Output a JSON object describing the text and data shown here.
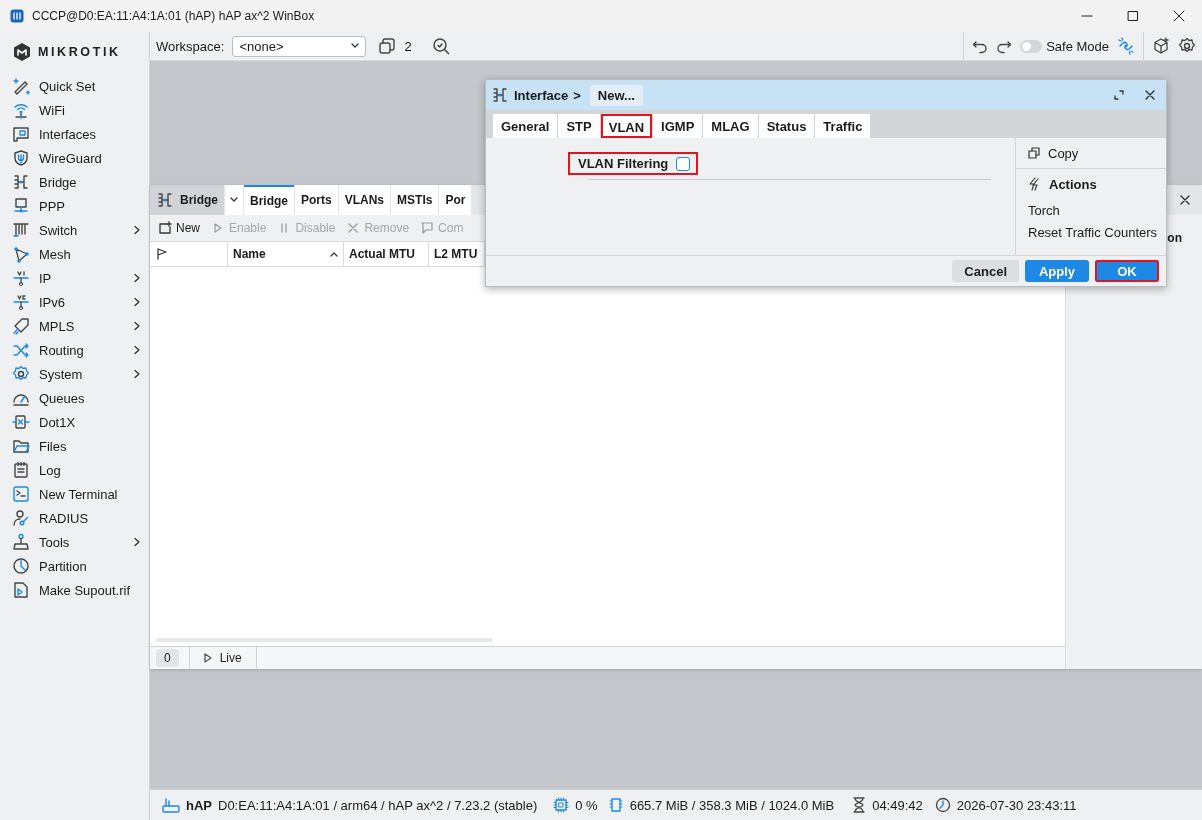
{
  "window": {
    "title": "CCCP@D0:EA:11:A4:1A:01 (hAP) hAP ax^2 WinBox"
  },
  "logo": {
    "text": "MIKROTIK"
  },
  "sidebar": {
    "items": [
      {
        "label": "Quick Set",
        "submenu": false
      },
      {
        "label": "WiFi",
        "submenu": false
      },
      {
        "label": "Interfaces",
        "submenu": false
      },
      {
        "label": "WireGuard",
        "submenu": false
      },
      {
        "label": "Bridge",
        "submenu": false
      },
      {
        "label": "PPP",
        "submenu": false
      },
      {
        "label": "Switch",
        "submenu": true
      },
      {
        "label": "Mesh",
        "submenu": false
      },
      {
        "label": "IP",
        "submenu": true
      },
      {
        "label": "IPv6",
        "submenu": true
      },
      {
        "label": "MPLS",
        "submenu": true
      },
      {
        "label": "Routing",
        "submenu": true
      },
      {
        "label": "System",
        "submenu": true
      },
      {
        "label": "Queues",
        "submenu": false
      },
      {
        "label": "Dot1X",
        "submenu": false
      },
      {
        "label": "Files",
        "submenu": false
      },
      {
        "label": "Log",
        "submenu": false
      },
      {
        "label": "New Terminal",
        "submenu": false
      },
      {
        "label": "RADIUS",
        "submenu": false
      },
      {
        "label": "Tools",
        "submenu": true
      },
      {
        "label": "Partition",
        "submenu": false
      },
      {
        "label": "Make Supout.rif",
        "submenu": false
      }
    ]
  },
  "toolbar": {
    "workspace_label": "Workspace:",
    "workspace_value": "<none>",
    "window_count": "2",
    "safe_mode": {
      "label": "Safe Mode",
      "on": false
    }
  },
  "bridge_window": {
    "title": "Bridge",
    "tabs": [
      {
        "label": "Bridge",
        "selected": true
      },
      {
        "label": "Ports",
        "selected": false
      },
      {
        "label": "VLANs",
        "selected": false
      },
      {
        "label": "MSTIs",
        "selected": false
      },
      {
        "label": "Por",
        "selected": false
      }
    ],
    "actions": [
      {
        "label": "New",
        "disabled": false
      },
      {
        "label": "Enable",
        "disabled": true
      },
      {
        "label": "Disable",
        "disabled": true
      },
      {
        "label": "Remove",
        "disabled": true
      },
      {
        "label": "Com",
        "disabled": true
      }
    ],
    "columns": [
      {
        "label": "Name",
        "sorted": true
      },
      {
        "label": "Actual MTU",
        "sorted": false
      },
      {
        "label": "L2 MTU",
        "sorted": false
      }
    ],
    "side_panel_text": "on",
    "item_count": "0",
    "live_label": "Live"
  },
  "dialog": {
    "breadcrumb": "Interface",
    "separator": ">",
    "title": "New...",
    "tabs": [
      {
        "label": "General",
        "selected": false,
        "highlighted": false
      },
      {
        "label": "STP",
        "selected": false,
        "highlighted": false
      },
      {
        "label": "VLAN",
        "selected": true,
        "highlighted": true
      },
      {
        "label": "IGMP",
        "selected": false,
        "highlighted": false
      },
      {
        "label": "MLAG",
        "selected": false,
        "highlighted": false
      },
      {
        "label": "Status",
        "selected": false,
        "highlighted": false
      },
      {
        "label": "Traffic",
        "selected": false,
        "highlighted": false
      }
    ],
    "fields": [
      {
        "label": "VLAN Filtering",
        "kind": "checkbox",
        "checked": false,
        "highlighted": true
      }
    ],
    "side_items": [
      {
        "label": "Copy",
        "kind": "command"
      },
      {
        "label": "Actions",
        "kind": "heading"
      },
      {
        "label": "Torch",
        "kind": "command"
      },
      {
        "label": "Reset Traffic Counters",
        "kind": "command"
      }
    ],
    "buttons": [
      {
        "label": "Cancel",
        "kind": "secondary",
        "highlighted": false
      },
      {
        "label": "Apply",
        "kind": "primary",
        "highlighted": false
      },
      {
        "label": "OK",
        "kind": "primary",
        "highlighted": true
      }
    ]
  },
  "status_bar": {
    "device": "hAP",
    "info": "D0:EA:11:A4:1A:01 / arm64 / hAP ax^2 / 7.23.2 (stable)",
    "cpu": "0 %",
    "memory": "665.7 MiB / 358.3 MiB / 1024.0 MiB",
    "uptime": "04:49:42",
    "clock": "2026-07-30 23:43:11"
  }
}
